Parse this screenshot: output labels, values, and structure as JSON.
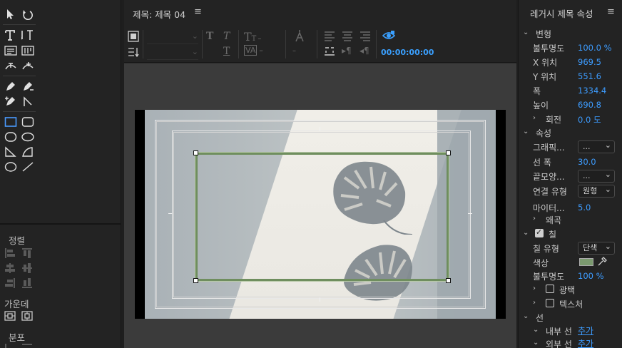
{
  "tools_panel": {
    "sections": {
      "align_label": "정렬",
      "center_label": "가운데",
      "distribute_label": "분포"
    }
  },
  "center": {
    "title": "제목: 제목 04",
    "menu_icon": "≡",
    "timecode": "00:00:00:00"
  },
  "props": {
    "title": "레거시 제목 속성",
    "menu_icon": "≡",
    "transform": {
      "label": "변형",
      "opacity_label": "불투명도",
      "opacity_value": "100.0 %",
      "x_label": "X 위치",
      "x_value": "969.5",
      "y_label": "Y 위치",
      "y_value": "551.6",
      "width_label": "폭",
      "width_value": "1334.4",
      "height_label": "높이",
      "height_value": "690.8",
      "rotation_label": "회전",
      "rotation_value": "0.0 도"
    },
    "properties": {
      "label": "속성",
      "graphic_label": "그래픽...",
      "graphic_value": "...",
      "line_width_label": "선 폭",
      "line_width_value": "30.0",
      "cap_label": "끝모양...",
      "cap_value": "...",
      "join_label": "연결 유형",
      "join_value": "원형",
      "miter_label": "마이터...",
      "miter_value": "5.0",
      "distort_label": "왜곡"
    },
    "fill": {
      "label": "칠",
      "fill_type_label": "칠 유형",
      "fill_type_value": "단색",
      "color_label": "색상",
      "color_hex": "#7b9a6f",
      "opacity_label": "불투명도",
      "opacity_value": "100 %",
      "sheen_label": "광택",
      "texture_label": "텍스처"
    },
    "stroke": {
      "label": "선",
      "inner_label": "내부 선",
      "inner_action": "추가",
      "outer_label": "외부 선",
      "outer_action": "추가"
    }
  }
}
